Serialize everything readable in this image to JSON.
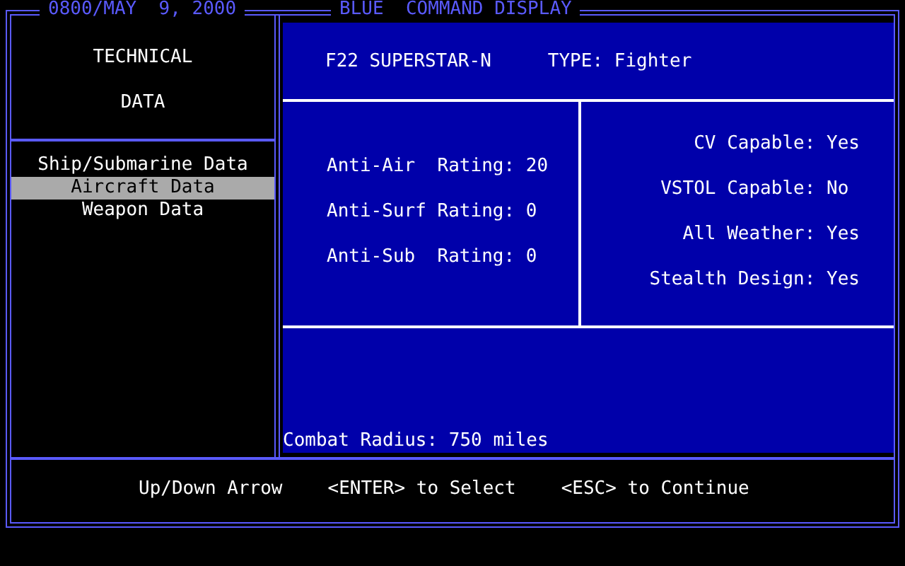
{
  "header": {
    "date": "0800/MAY  9, 2000",
    "title": "BLUE  COMMAND DISPLAY"
  },
  "sidebar": {
    "heading": [
      "TECHNICAL",
      "DATA"
    ],
    "items": [
      {
        "label": "Ship/Submarine Data",
        "selected": false
      },
      {
        "label": "Aircraft Data",
        "selected": true
      },
      {
        "label": "Weapon Data",
        "selected": false
      }
    ]
  },
  "unit": {
    "name": "F22 SUPERSTAR-N",
    "type": "TYPE: Fighter"
  },
  "ratings": [
    "Anti-Air  Rating: 20",
    "Anti-Surf Rating: 0",
    "Anti-Sub  Rating: 0"
  ],
  "capabilities": [
    "CV Capable: Yes",
    "VSTOL Capable: No ",
    "All Weather: Yes",
    "Stealth Design: Yes"
  ],
  "combat_radius": "Combat Radius: 750 miles",
  "footer": [
    "Up/Down Arrow",
    "<ENTER> to Select",
    "<ESC> to Continue"
  ]
}
